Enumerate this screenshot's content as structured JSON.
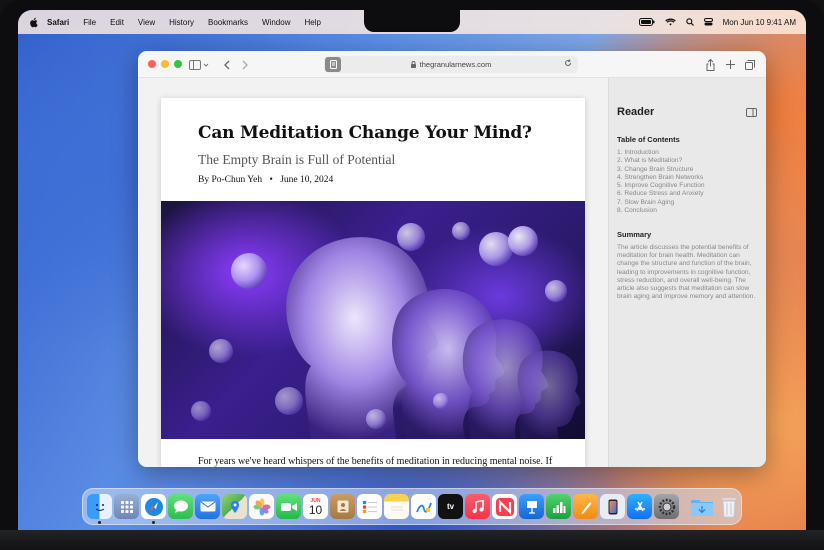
{
  "menubar": {
    "app_name": "Safari",
    "items": [
      "File",
      "Edit",
      "View",
      "History",
      "Bookmarks",
      "Window",
      "Help"
    ],
    "clock": "Mon Jun 10  9:41 AM"
  },
  "browser": {
    "url": "thegranularnews.com"
  },
  "article": {
    "title": "Can Meditation Change Your Mind?",
    "subtitle": "The Empty Brain is Full of Potential",
    "author": "By Po-Chun Yeh",
    "separator": "•",
    "date": "June 10, 2024",
    "body": "For years we've heard whispers of the benefits of meditation in reducing mental noise. If you can manage to clear your mind, you might find life a little bit lighter."
  },
  "reader": {
    "title": "Reader",
    "toc_title": "Table of Contents",
    "toc": [
      "1.  Introduction",
      "2.  What is Meditation?",
      "3.  Change Brain Structure",
      "4.  Strengthen Brain Networks",
      "5.  Improve Cognitive Function",
      "6.  Reduce Stress and Anxiety",
      "7.  Slow Brain Aging",
      "8.  Conclusion"
    ],
    "summary_title": "Summary",
    "summary": "The article discusses the potential benefits of meditation for brain health. Meditation can change the structure and function of the brain, leading to improvements in cognitive function, stress reduction, and overall well-being. The article also suggests that meditation can slow brain aging and improve memory and attention."
  },
  "dock": {
    "calendar_month": "JUN",
    "calendar_day": "10",
    "tv_label": "tv",
    "apps": [
      {
        "name": "finder",
        "color": "#2f8ef6",
        "running": true
      },
      {
        "name": "launchpad",
        "color": "#8aa0c8"
      },
      {
        "name": "safari",
        "color": "#1e88e5",
        "running": true
      },
      {
        "name": "messages",
        "color": "#34c759"
      },
      {
        "name": "mail",
        "color": "#3b8ff0"
      },
      {
        "name": "maps",
        "color": "#5cb85c"
      },
      {
        "name": "photos",
        "color": "#f5f5f5"
      },
      {
        "name": "facetime",
        "color": "#2ecc59"
      },
      {
        "name": "calendar",
        "color": "#ffffff"
      },
      {
        "name": "contacts",
        "color": "#c89a5a"
      },
      {
        "name": "reminders",
        "color": "#ffffff"
      },
      {
        "name": "notes",
        "color": "#f7d154"
      },
      {
        "name": "freeform",
        "color": "#ffffff"
      },
      {
        "name": "apple-tv",
        "color": "#111111"
      },
      {
        "name": "music",
        "color": "#fa3c4c"
      },
      {
        "name": "news",
        "color": "#f5f5f5"
      },
      {
        "name": "keynote",
        "color": "#1d7ce0"
      },
      {
        "name": "numbers",
        "color": "#2fb84f"
      },
      {
        "name": "pages",
        "color": "#f5a623"
      },
      {
        "name": "iphone-mirroring",
        "color": "#dfe6ee"
      },
      {
        "name": "app-store",
        "color": "#1a8cf5"
      },
      {
        "name": "system-settings",
        "color": "#8e8e93"
      },
      {
        "name": "downloads-folder",
        "color": "#5aaef0"
      },
      {
        "name": "trash",
        "color": "#e6e9ee"
      }
    ]
  }
}
